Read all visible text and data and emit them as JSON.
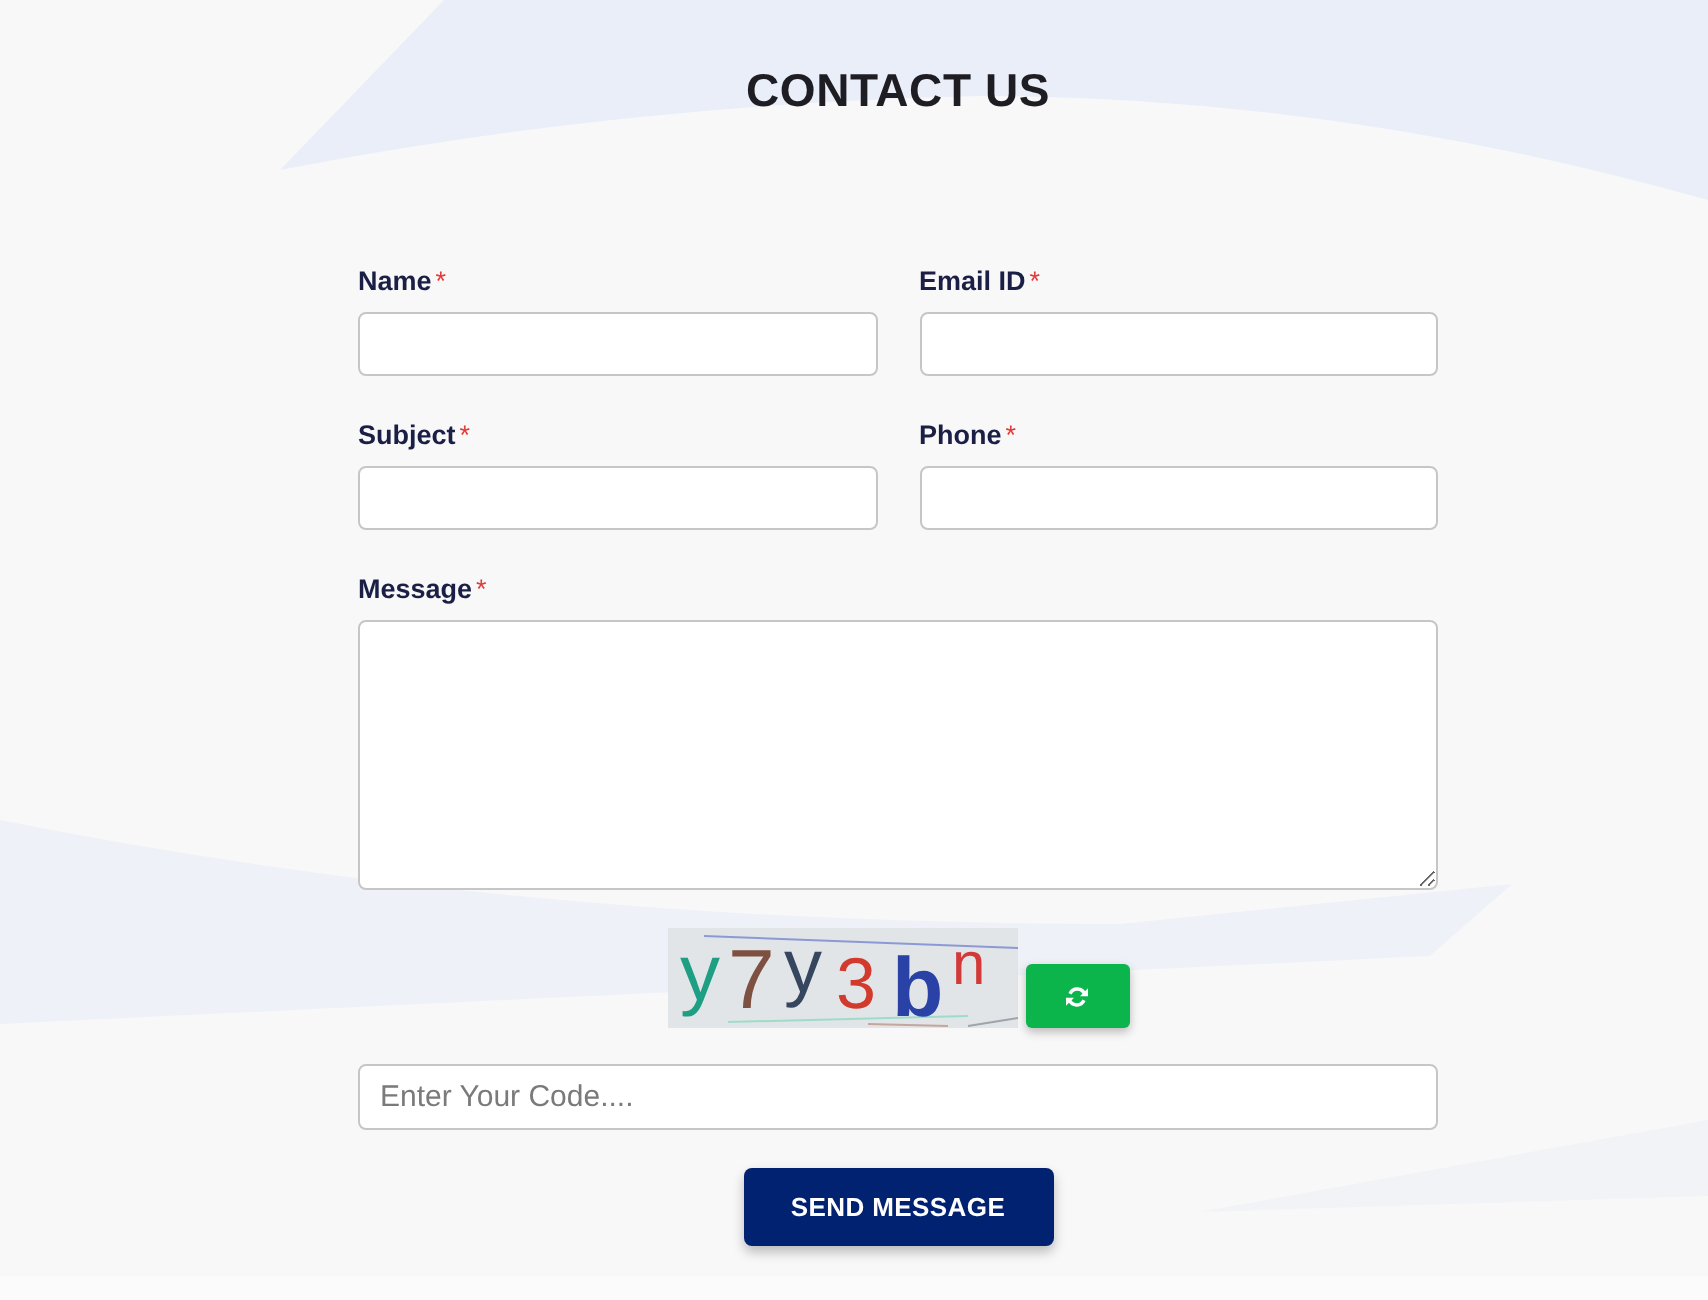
{
  "heading": "CONTACT US",
  "field_rows": [
    [
      {
        "label": "Name",
        "required_mark": "*"
      },
      {
        "label": "Email ID",
        "required_mark": "*"
      }
    ],
    [
      {
        "label": "Subject",
        "required_mark": "*"
      },
      {
        "label": "Phone",
        "required_mark": "*"
      }
    ]
  ],
  "message": {
    "label": "Message",
    "required_mark": "*"
  },
  "captcha": {
    "code": "y7y3bn"
  },
  "code_field": {
    "placeholder": "Enter Your Code...."
  },
  "submit_button": "SEND MESSAGE"
}
